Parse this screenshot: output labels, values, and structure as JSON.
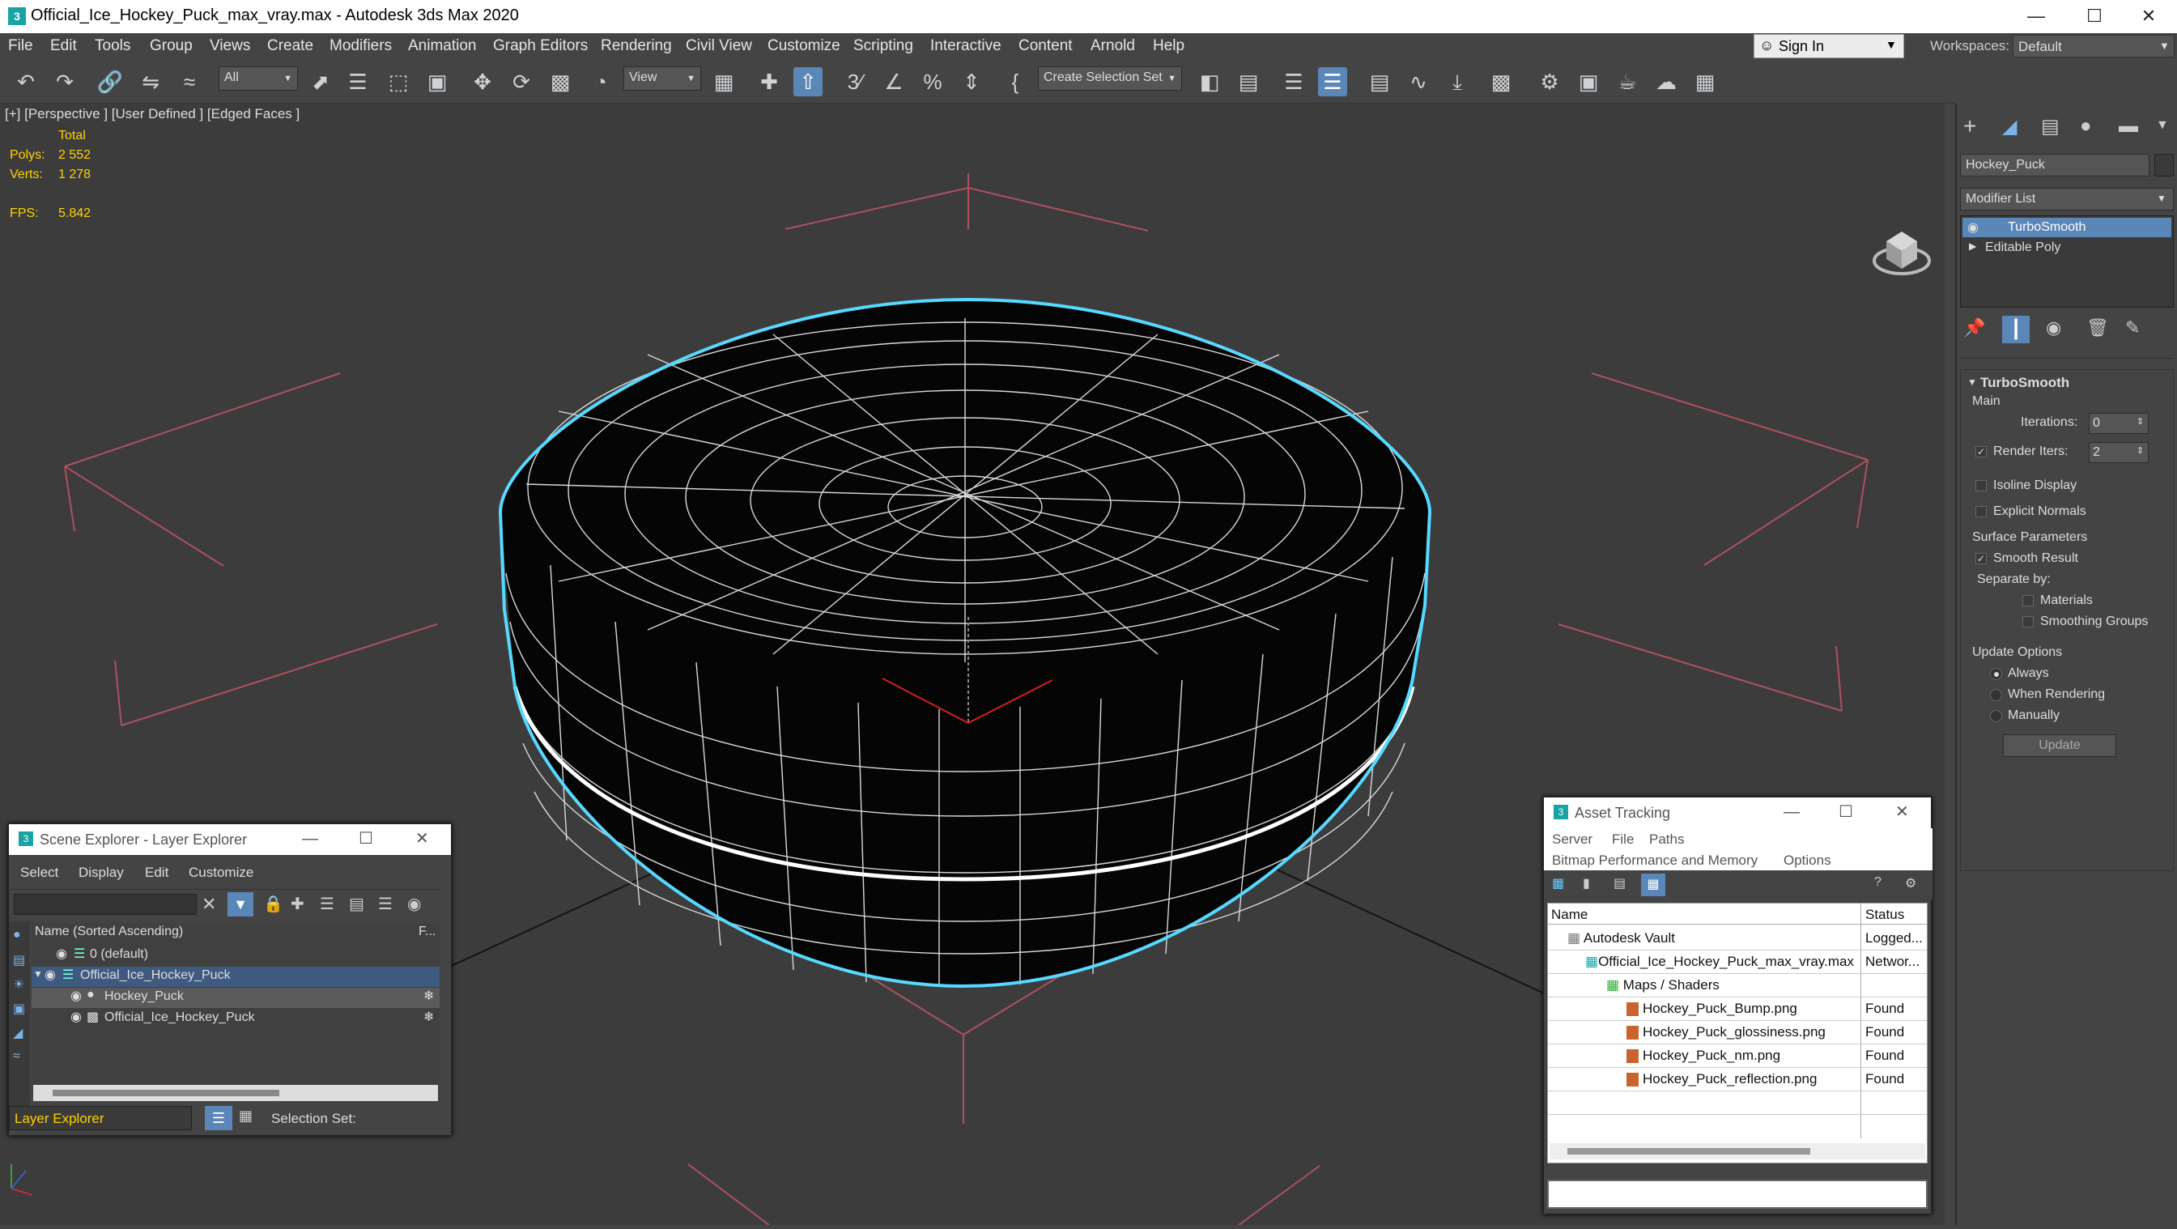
{
  "window": {
    "title": "Official_Ice_Hockey_Puck_max_vray.max - Autodesk 3ds Max 2020"
  },
  "menu": [
    "File",
    "Edit",
    "Tools",
    "Group",
    "Views",
    "Create",
    "Modifiers",
    "Animation",
    "Graph Editors",
    "Rendering",
    "Civil View",
    "Customize",
    "Scripting",
    "Interactive",
    "Content",
    "Arnold",
    "Help"
  ],
  "account": {
    "sign_in": "Sign In",
    "workspaces_label": "Workspaces:",
    "workspace": "Default"
  },
  "toolbar": {
    "filter": "All",
    "ref_coord": "View",
    "selection_set": "Create Selection Set"
  },
  "viewport": {
    "label": "[+] [Perspective ] [User Defined ] [Edged Faces ]",
    "stats_header": "Total",
    "polys_label": "Polys:",
    "polys": "2 552",
    "verts_label": "Verts:",
    "verts": "1 278",
    "fps_label": "FPS:",
    "fps": "5.842"
  },
  "command_panel": {
    "object_name": "Hockey_Puck",
    "modifier_list": "Modifier List",
    "stack": [
      "TurboSmooth",
      "Editable Poly"
    ],
    "rollout_title": "TurboSmooth",
    "main": "Main",
    "iterations_label": "Iterations:",
    "iterations": "0",
    "render_iters_label": "Render Iters:",
    "render_iters": "2",
    "isoline": "Isoline Display",
    "explicit_normals": "Explicit Normals",
    "surface_params": "Surface Parameters",
    "smooth_result": "Smooth Result",
    "separate_by": "Separate by:",
    "materials": "Materials",
    "smoothing_groups": "Smoothing Groups",
    "update_options": "Update Options",
    "always": "Always",
    "when_rendering": "When Rendering",
    "manually": "Manually",
    "update_button": "Update"
  },
  "scene_explorer": {
    "title": "Scene Explorer - Layer Explorer",
    "menu": [
      "Select",
      "Display",
      "Edit",
      "Customize"
    ],
    "column": "Name (Sorted Ascending)",
    "column2": "F...",
    "rows": [
      "0 (default)",
      "Official_Ice_Hockey_Puck",
      "Hockey_Puck",
      "Official_Ice_Hockey_Puck"
    ],
    "footer_mode": "Layer Explorer",
    "footer_selset": "Selection Set:"
  },
  "asset_tracking": {
    "title": "Asset Tracking",
    "menu": [
      "Server",
      "File",
      "Paths"
    ],
    "menu2": [
      "Bitmap Performance and Memory",
      "Options"
    ],
    "col_name": "Name",
    "col_status": "Status",
    "rows": [
      {
        "name": "Autodesk Vault",
        "status": "Logged..."
      },
      {
        "name": "Official_Ice_Hockey_Puck_max_vray.max",
        "status": "Networ..."
      },
      {
        "name": "Maps / Shaders",
        "status": ""
      },
      {
        "name": "Hockey_Puck_Bump.png",
        "status": "Found"
      },
      {
        "name": "Hockey_Puck_glossiness.png",
        "status": "Found"
      },
      {
        "name": "Hockey_Puck_nm.png",
        "status": "Found"
      },
      {
        "name": "Hockey_Puck_reflection.png",
        "status": "Found"
      }
    ]
  },
  "colors": {
    "accent": "#5b86b8",
    "selection": "#57d9ff",
    "grid": "#b05060",
    "stats": "#ffd200"
  }
}
